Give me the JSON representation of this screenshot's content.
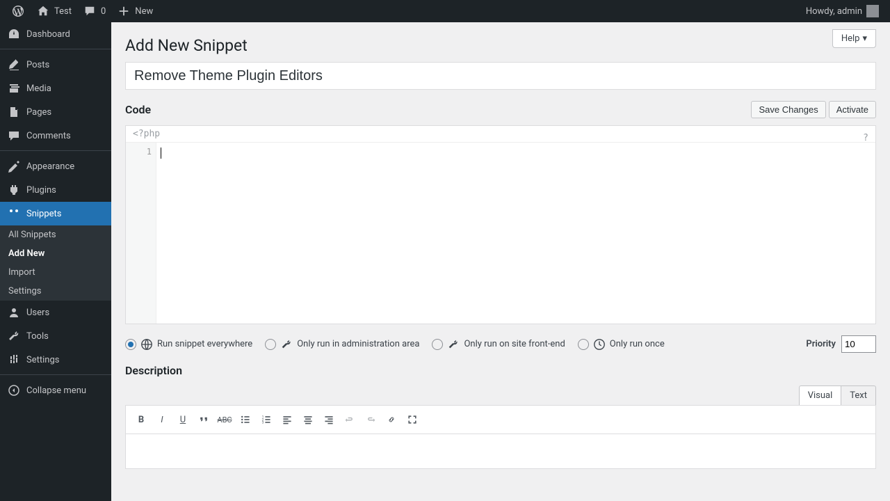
{
  "adminbar": {
    "site_name": "Test",
    "comments_count": "0",
    "new_label": "New",
    "howdy": "Howdy, admin"
  },
  "sidebar": {
    "items": [
      {
        "label": "Dashboard",
        "icon": "dashboard"
      },
      {
        "label": "Posts",
        "icon": "posts"
      },
      {
        "label": "Media",
        "icon": "media"
      },
      {
        "label": "Pages",
        "icon": "pages"
      },
      {
        "label": "Comments",
        "icon": "comments"
      },
      {
        "label": "Appearance",
        "icon": "appearance"
      },
      {
        "label": "Plugins",
        "icon": "plugins"
      },
      {
        "label": "Snippets",
        "icon": "snippets"
      },
      {
        "label": "Users",
        "icon": "users"
      },
      {
        "label": "Tools",
        "icon": "tools"
      },
      {
        "label": "Settings",
        "icon": "settings"
      },
      {
        "label": "Collapse menu",
        "icon": "collapse"
      }
    ],
    "snippets_submenu": [
      {
        "label": "All Snippets"
      },
      {
        "label": "Add New"
      },
      {
        "label": "Import"
      },
      {
        "label": "Settings"
      }
    ]
  },
  "page": {
    "help": "Help",
    "title": "Add New Snippet",
    "snippet_title": "Remove Theme Plugin Editors",
    "code_heading": "Code",
    "save_btn": "Save Changes",
    "activate_btn": "Activate",
    "php_open": "<?php",
    "php_close_hint": "?",
    "line_number": "1",
    "scope": {
      "everywhere": "Run snippet everywhere",
      "admin": "Only run in administration area",
      "frontend": "Only run on site front-end",
      "once": "Only run once"
    },
    "priority_label": "Priority",
    "priority_value": "10",
    "description_heading": "Description",
    "desc_tabs": {
      "visual": "Visual",
      "text": "Text"
    }
  }
}
